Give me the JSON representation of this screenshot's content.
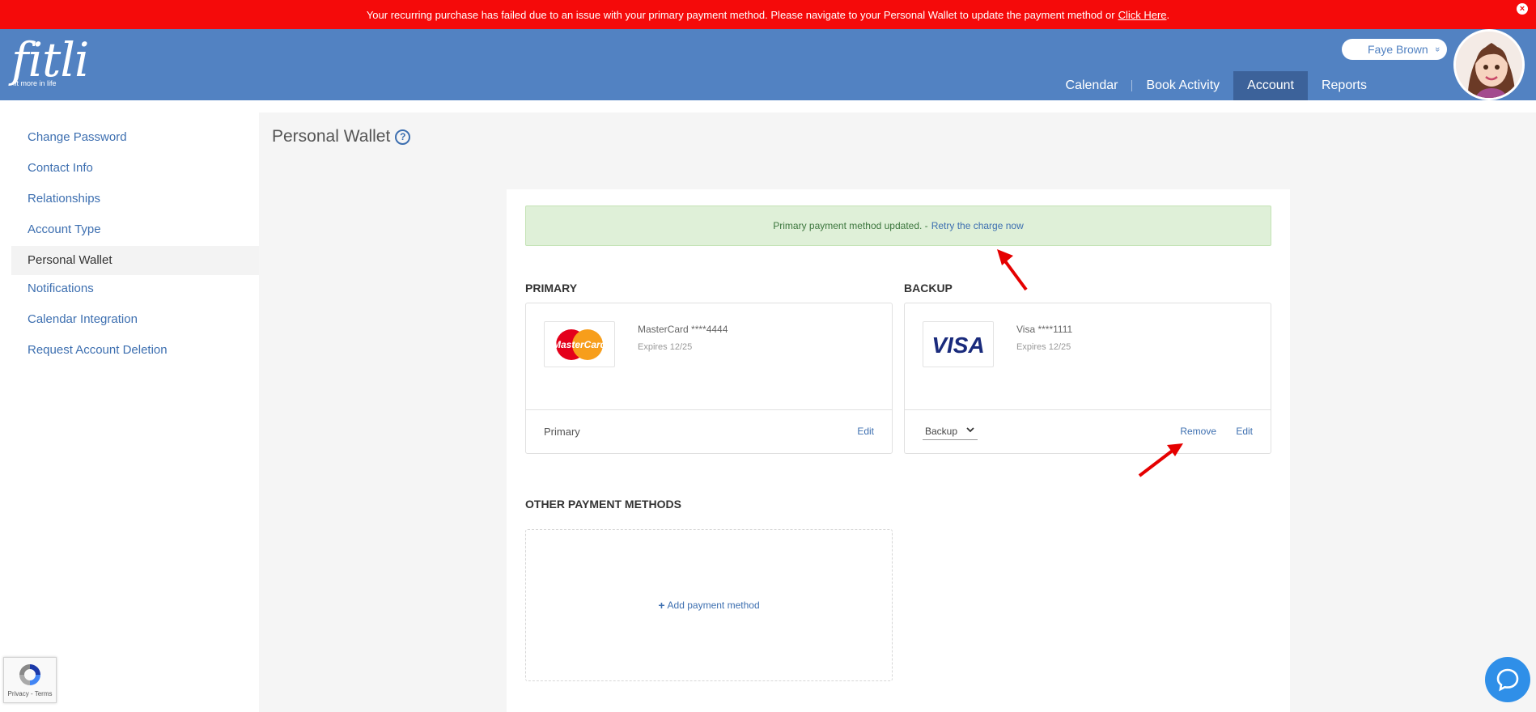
{
  "banner": {
    "message": "Your recurring purchase has failed due to an issue with your primary payment method. Please navigate to your Personal Wallet to update the payment method or",
    "link": "Click Here",
    "period": ".",
    "close_glyph": "×"
  },
  "header": {
    "logo_word": "fitli",
    "logo_tagline": "fit more in life",
    "user_name": "Faye Brown",
    "user_chevron": "»",
    "nav": [
      "Calendar",
      "Book Activity",
      "Account",
      "Reports"
    ],
    "active_nav": "Account"
  },
  "sidebar": {
    "items": [
      {
        "label": "Change Password"
      },
      {
        "label": "Contact Info"
      },
      {
        "label": "Relationships"
      },
      {
        "label": "Account Type"
      },
      {
        "label": "Personal Wallet"
      },
      {
        "label": "Notifications"
      },
      {
        "label": "Calendar Integration"
      },
      {
        "label": "Request Account Deletion"
      }
    ],
    "active": "Personal Wallet"
  },
  "page": {
    "title": "Personal Wallet",
    "help_glyph": "?"
  },
  "alert_success": {
    "text": "Primary payment method updated. -",
    "link": "Retry the charge now"
  },
  "sections": {
    "primary": "PRIMARY",
    "backup": "BACKUP",
    "other": "OTHER PAYMENT METHODS"
  },
  "primary_card": {
    "logo_text": "MasterCard",
    "name": "MasterCard ****4444",
    "expires": "Expires 12/25",
    "role": "Primary",
    "edit": "Edit"
  },
  "backup_card": {
    "logo_text": "VISA",
    "name": "Visa ****1111",
    "expires": "Expires 12/25",
    "role": "Backup",
    "remove": "Remove",
    "edit": "Edit"
  },
  "add_method": {
    "plus": "+",
    "label": "Add payment method"
  },
  "recaptcha": {
    "text": "Privacy - Terms"
  },
  "colors": {
    "banner": "#f50a0a",
    "header": "#5282c2",
    "active_nav": "#3c629a",
    "link": "#3d6fb0",
    "success_bg": "#dff0d8",
    "arrow": "#e50000"
  }
}
